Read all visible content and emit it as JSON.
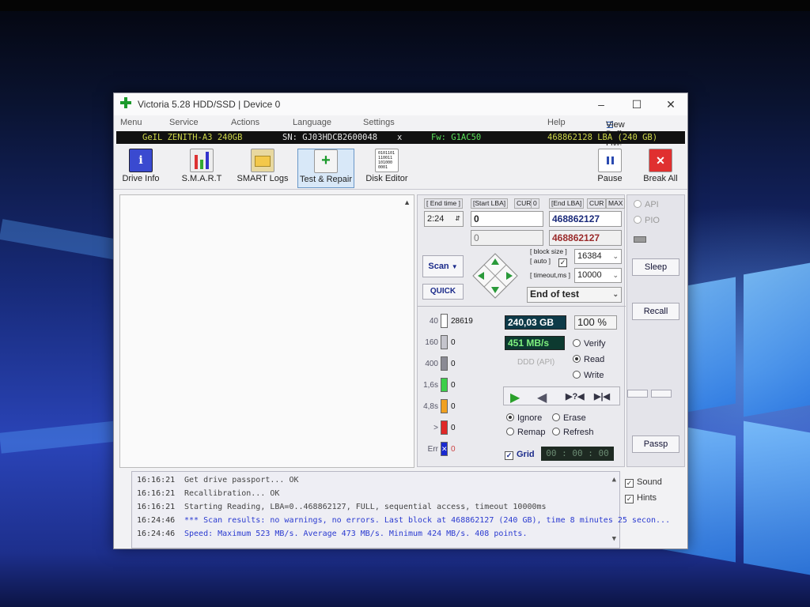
{
  "window": {
    "title": "Victoria 5.28 HDD/SSD | Device 0",
    "min": "–",
    "max": "☐",
    "close": "✕"
  },
  "menu": {
    "items": [
      "Menu",
      "Service",
      "Actions",
      "Language",
      "Settings",
      "Help"
    ],
    "view_buffer": "View Buffer Live"
  },
  "drive": {
    "model": "GeIL ZENITH-A3 240GB",
    "serial": "SN: GJ03HDCB2600048",
    "x": "x",
    "firmware": "Fw: G1AC50",
    "lba": "468862128 LBA (240 GB)"
  },
  "toolbar": {
    "drive_info": "Drive Info",
    "smart": "S.M.A.R.T",
    "smart_logs": "SMART Logs",
    "test_repair": "Test & Repair",
    "disk_editor": "Disk Editor",
    "pause": "Pause",
    "break_all": "Break All",
    "disk_icon_text": "0101101\n110011\n101000\n0001"
  },
  "test": {
    "end_time_label": "[ End time ]",
    "end_time": "2:24",
    "start_lba_label": "[Start LBA]",
    "cur": "CUR",
    "zero": "0",
    "start_lba": "0",
    "start_lba_cur": "0",
    "end_lba_label": "[End LBA]",
    "cur2": "CUR",
    "max": "MAX",
    "end_lba": "468862127",
    "end_lba_cur": "468862127",
    "scan": "Scan",
    "quick": "QUICK",
    "block_size_label": "[ block size ]",
    "auto_label": "[ auto ]",
    "block_size": "16384",
    "timeout_label": "[ timeout,ms ]",
    "timeout": "10000",
    "end_action": "End of test",
    "capacity_done": "240,03 GB",
    "percent": "100",
    "percent_sign": "%",
    "speed": "451 MB/s",
    "ddd": "DDD (API)",
    "verify": "Verify",
    "read": "Read",
    "write": "Write",
    "ignore": "Ignore",
    "erase": "Erase",
    "remap": "Remap",
    "refresh": "Refresh",
    "grid": "Grid",
    "timer": "00 : 00 : 00",
    "err_label": "Err",
    "err_count": "0"
  },
  "histogram": [
    {
      "label": "40",
      "count": "28619",
      "color": "#ffffff"
    },
    {
      "label": "160",
      "count": "0",
      "color": "#c4c4cc"
    },
    {
      "label": "400",
      "count": "0",
      "color": "#8a8a94"
    },
    {
      "label": "1,6s",
      "count": "0",
      "color": "#3ccf4a"
    },
    {
      "label": "4,8s",
      "count": "0",
      "color": "#f0a020"
    },
    {
      "label": ">",
      "count": "0",
      "color": "#e02828"
    }
  ],
  "side": {
    "api": "API",
    "pio": "PIO",
    "sleep": "Sleep",
    "recall": "Recall",
    "passp": "Passp",
    "sound": "Sound",
    "hints": "Hints"
  },
  "log": [
    {
      "time": "16:16:21",
      "msg": "Get drive passport... OK",
      "blue": false
    },
    {
      "time": "16:16:21",
      "msg": "Recallibration... OK",
      "blue": false
    },
    {
      "time": "16:16:21",
      "msg": "Starting Reading, LBA=0..468862127, FULL, sequential access, timeout 10000ms",
      "blue": false
    },
    {
      "time": "16:24:46",
      "msg": "*** Scan results: no warnings, no errors. Last block at 468862127 (240 GB), time 8 minutes 25 secon...",
      "blue": true
    },
    {
      "time": "16:24:46",
      "msg": "Speed: Maximum 523 MB/s. Average 473 MB/s. Minimum 424 MB/s. 408 points.",
      "blue": true
    }
  ]
}
